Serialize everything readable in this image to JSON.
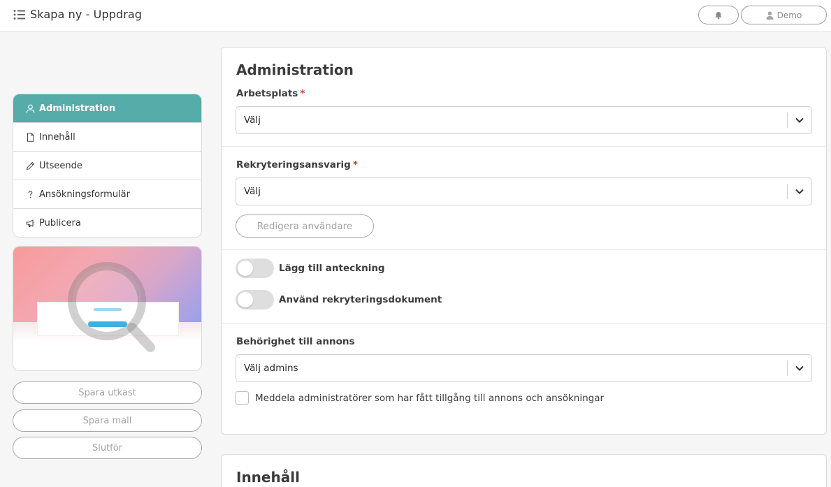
{
  "header": {
    "title": "Skapa ny - Uppdrag",
    "user_label": "Demo",
    "menu_icon": "list-icon",
    "bell_icon": "bell-icon",
    "user_icon": "user-icon"
  },
  "sidebar": {
    "items": [
      {
        "label": "Administration",
        "icon": "user-icon",
        "active": true
      },
      {
        "label": "Innehåll",
        "icon": "document-icon",
        "active": false
      },
      {
        "label": "Utseende",
        "icon": "pencil-icon",
        "active": false
      },
      {
        "label": "Ansökningsformulär",
        "icon": "question-icon",
        "active": false
      },
      {
        "label": "Publicera",
        "icon": "megaphone-icon",
        "active": false
      }
    ],
    "accent_color": "#55aca8",
    "actions": {
      "save_draft": "Spara utkast",
      "save_template": "Spara mall",
      "finish": "Slutför"
    }
  },
  "main": {
    "section_title": "Administration",
    "workplace": {
      "label": "Arbetsplats",
      "required": "*",
      "value": "Välj"
    },
    "recruiter": {
      "label": "Rekryteringsansvarig",
      "required": "*",
      "value": "Välj"
    },
    "edit_users_button": "Redigera användare",
    "toggles": [
      {
        "label": "Lägg till anteckning",
        "on": false
      },
      {
        "label": "Använd rekryteringsdokument",
        "on": false
      }
    ],
    "permission": {
      "label": "Behörighet till annons",
      "value": "Välj admins"
    },
    "notify_checkbox": {
      "label": "Meddela administratörer som har fått tillgång till annons och ansökningar",
      "checked": false
    },
    "next_section_title": "Innehåll"
  }
}
